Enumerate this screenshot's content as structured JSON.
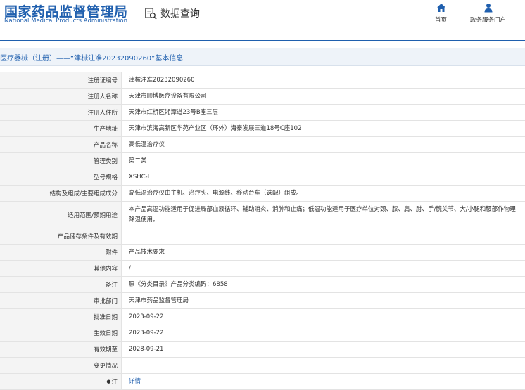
{
  "header": {
    "logo_cn": "国家药品监督管理局",
    "logo_en": "National Medical Products Administration",
    "page_heading": "数据查询",
    "nav": [
      {
        "label": "首页",
        "icon": "home-icon"
      },
      {
        "label": "政务服务门户",
        "icon": "person-icon"
      }
    ]
  },
  "title_bar": "医疗器械（注册）——“津械注准20232090260”基本信息",
  "rows": [
    {
      "label": "注册证编号",
      "value": "津械注准20232090260"
    },
    {
      "label": "注册人名称",
      "value": "天津市顺博医疗设备有限公司"
    },
    {
      "label": "注册人住所",
      "value": "天津市红桥区湘潭道23号B座三层"
    },
    {
      "label": "生产地址",
      "value": "天津市滨海高新区华苑产业区（环外）海泰发展三道18号C座102"
    },
    {
      "label": "产品名称",
      "value": "高低温治疗仪"
    },
    {
      "label": "管理类别",
      "value": "第二类"
    },
    {
      "label": "型号规格",
      "value": "XSHC-I"
    },
    {
      "label": "结构及组成/主要组成成分",
      "value": "高低温治疗仪由主机、治疗头、电源线、移动台车（选配）组成。"
    },
    {
      "label": "适用范围/预期用途",
      "value": "本产品高温功能适用于促进局部血液循环、辅助消炎、消肿和止痛；低温功能适用于医疗单位对颈、膝、肩、肘、手/腕关节、大/小腿和腰部作物理降温使用。"
    },
    {
      "label": "产品储存条件及有效期",
      "value": ""
    },
    {
      "label": "附件",
      "value": "产品技术要求"
    },
    {
      "label": "其他内容",
      "value": "/"
    },
    {
      "label": "备注",
      "value": "原《分类目录》产品分类编码：6858"
    },
    {
      "label": "审批部门",
      "value": "天津市药品监督管理局"
    },
    {
      "label": "批准日期",
      "value": "2023-09-22"
    },
    {
      "label": "生效日期",
      "value": "2023-09-22"
    },
    {
      "label": "有效期至",
      "value": "2028-09-21"
    },
    {
      "label": "变更情况",
      "value": ""
    },
    {
      "label": "注",
      "value": "详情",
      "link": true
    }
  ],
  "colors": {
    "brand_blue": "#1f5fae",
    "label_bg": "#f4f4f4",
    "title_bg": "#eef3f9"
  }
}
